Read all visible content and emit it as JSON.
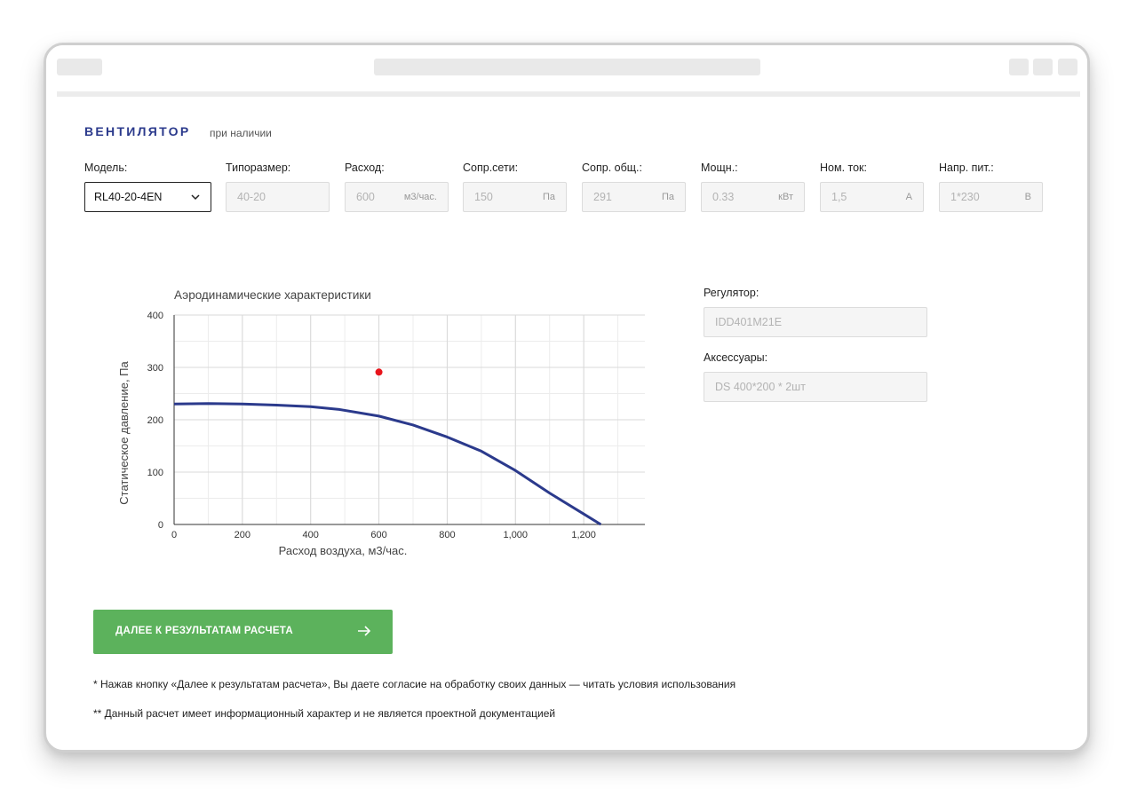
{
  "section": {
    "title": "ВЕНТИЛЯТОР",
    "subtitle": "при наличии"
  },
  "fields": [
    {
      "label": "Модель:",
      "value": "RL40-20-4EN",
      "unit": "",
      "type": "select"
    },
    {
      "label": "Типоразмер:",
      "value": "40-20",
      "unit": ""
    },
    {
      "label": "Расход:",
      "value": "600",
      "unit": "м3/час."
    },
    {
      "label": "Сопр.сети:",
      "value": "150",
      "unit": "Па"
    },
    {
      "label": "Сопр. общ.:",
      "value": "291",
      "unit": "Па"
    },
    {
      "label": "Мощн.:",
      "value": "0.33",
      "unit": "кВт"
    },
    {
      "label": "Ном. ток:",
      "value": "1,5",
      "unit": "А"
    },
    {
      "label": "Напр. пит.:",
      "value": "1*230",
      "unit": "В"
    }
  ],
  "regulator": {
    "label": "Регулятор:",
    "value": "IDD401M21E"
  },
  "accessories": {
    "label": "Аксессуары:",
    "value": "DS 400*200 * 2шт"
  },
  "cta": {
    "label": "ДАЛЕЕ К РЕЗУЛЬТАТАМ РАСЧЕТА"
  },
  "notes": [
    "* Нажав кнопку «Далее к результатам расчета», Вы даете согласие на обработку своих данных — читать условия использования",
    "** Данный расчет имеет информационный характер и не является проектной документацией"
  ],
  "colors": {
    "accent": "#2b3a8c",
    "curve": "#2b3a8c",
    "point": "#e8141b",
    "button": "#5cb25c"
  },
  "chart_data": {
    "type": "line",
    "title": "Аэродинамические характеристики",
    "xlabel": "Расход воздуха, м3/час.",
    "ylabel": "Статическое давление, Па",
    "xlim": [
      0,
      1400
    ],
    "ylim": [
      0,
      400
    ],
    "xticks": [
      0,
      200,
      400,
      600,
      800,
      1000,
      1200
    ],
    "xtick_labels": [
      "0",
      "200",
      "400",
      "600",
      "800",
      "1,000",
      "1,200"
    ],
    "yticks": [
      0,
      100,
      200,
      300,
      400
    ],
    "ytick_labels": [
      "0",
      "100",
      "200",
      "300",
      "400"
    ],
    "grid": true,
    "series": [
      {
        "x": [
          0,
          100,
          200,
          300,
          400,
          480,
          600,
          700,
          800,
          900,
          1000,
          1100,
          1200,
          1250
        ],
        "y": [
          230,
          231,
          230,
          228,
          225,
          220,
          207,
          190,
          167,
          140,
          103,
          60,
          20,
          0
        ]
      }
    ],
    "points": [
      {
        "x": 600,
        "y": 291
      }
    ]
  }
}
